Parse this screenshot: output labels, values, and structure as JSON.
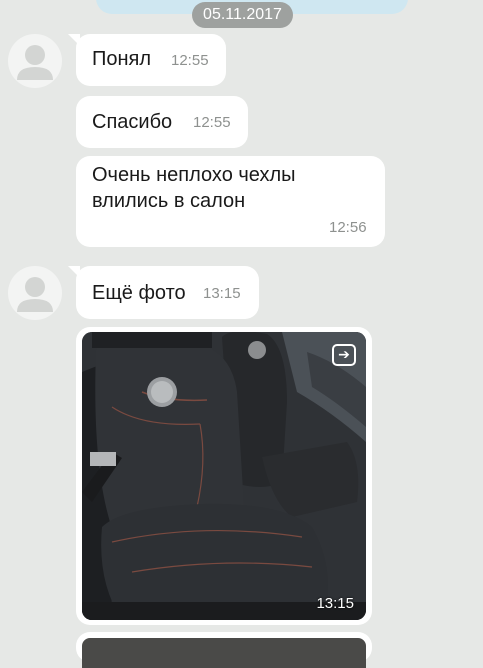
{
  "date_separator": "05.11.2017",
  "messages": [
    {
      "text": "Понял",
      "time": "12:55"
    },
    {
      "text": "Спасибо",
      "time": "12:55"
    },
    {
      "text_line1": "Очень неплохо чехлы",
      "text_line2": "влились в салон",
      "time": "12:56"
    },
    {
      "text": "Ещё фото",
      "time": "13:15"
    }
  ],
  "photo_message": {
    "time": "13:15",
    "share_icon": "share-arrow-icon"
  },
  "colors": {
    "background": "#e6e8e6",
    "bubble": "#ffffff",
    "date_pill": "#9ea19f",
    "time_text": "#8e918f",
    "top_bubble": "#cfe7f1"
  }
}
